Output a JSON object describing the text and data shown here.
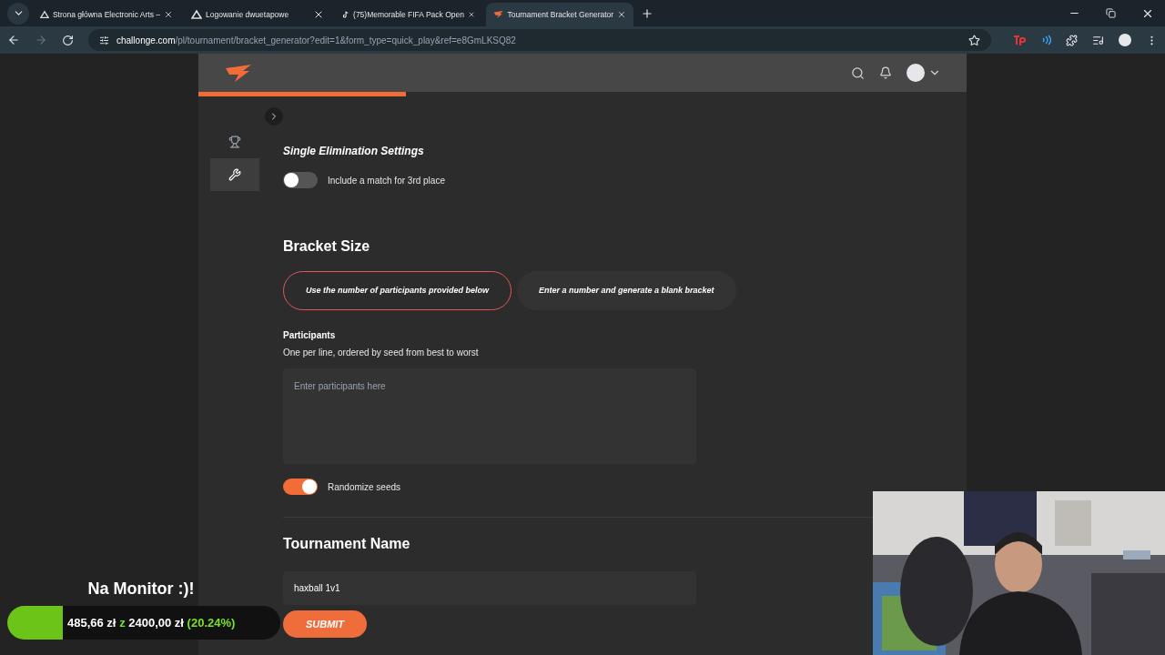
{
  "browser": {
    "tabs": [
      {
        "title": "Strona główna Electronic Arts –",
        "selected": false,
        "kind": "ea"
      },
      {
        "title": "Logowanie dwuetapowe",
        "selected": false,
        "kind": "ea"
      },
      {
        "title": "(75)Memorable FIFA Pack Open",
        "selected": false,
        "kind": "tiktok"
      },
      {
        "title": "Tournament Bracket Generator",
        "selected": true,
        "kind": "challonge"
      }
    ],
    "url_host": "challonge.com",
    "url_path": "/pl/tournament/bracket_generator?edit=1&form_type=quick_play&ref=e8GmLKSQ82"
  },
  "page": {
    "progress": {
      "level": 0.27
    },
    "sidebar": [
      {
        "kind": "trophy",
        "selected": false
      },
      {
        "kind": "wrench",
        "selected": true
      }
    ],
    "settings_title": "Single Elimination Settings",
    "third_place": {
      "label": "Include a match for 3rd place",
      "on": false
    },
    "bracket_size": {
      "title": "Bracket Size",
      "options": [
        {
          "label": "Use the number of participants provided below",
          "selected": true
        },
        {
          "label": "Enter a number and generate a blank bracket",
          "selected": false
        }
      ]
    },
    "participants": {
      "label": "Participants",
      "hint": "One per line, ordered by seed from best to worst",
      "placeholder": "Enter participants here"
    },
    "randomize": {
      "label": "Randomize seeds",
      "on": true
    },
    "tournament_name": {
      "title": "Tournament Name",
      "value": "haxball 1v1"
    },
    "submit": "SUBMIT"
  },
  "overlay": {
    "goal_title": "Na Monitor :)!",
    "raised": "485,66 zł",
    "separator": "z",
    "target": "2400,00 zł",
    "percent": "(20.24%)",
    "level": 0.2024
  }
}
